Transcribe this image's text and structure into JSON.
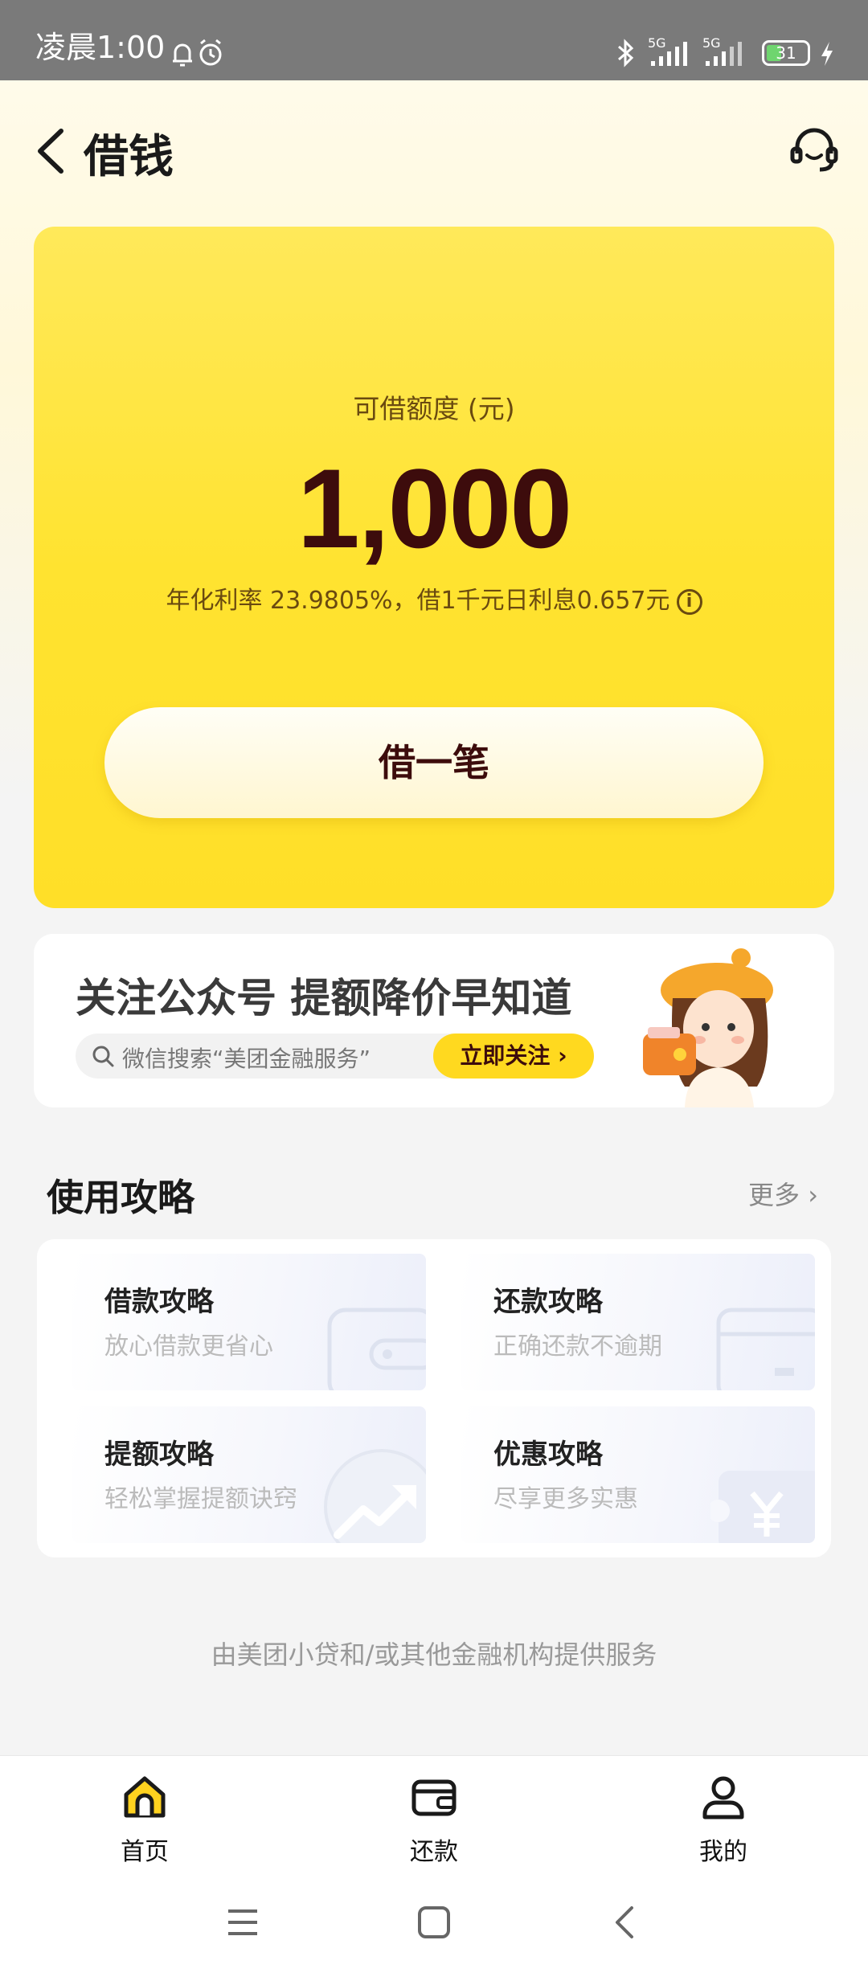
{
  "status_bar": {
    "time": "凌晨1:00",
    "signal_1": "5G",
    "signal_2": "5G",
    "battery": "31"
  },
  "header": {
    "title": "借钱"
  },
  "credit_card": {
    "label": "可借额度 (元)",
    "amount": "1,000",
    "rate_text": "年化利率 23.9805%，借1千元日利息0.657元",
    "button_label": "借一笔"
  },
  "banner": {
    "title": "关注公众号 提额降价早知道",
    "search_text": "微信搜索“美团金融服务”",
    "follow_label": "立即关注 ›"
  },
  "guides": {
    "title": "使用攻略",
    "more_label": "更多 ›",
    "items": [
      {
        "title": "借款攻略",
        "subtitle": "放心借款更省心"
      },
      {
        "title": "还款攻略",
        "subtitle": "正确还款不逾期"
      },
      {
        "title": "提额攻略",
        "subtitle": "轻松掌握提额诀窍"
      },
      {
        "title": "优惠攻略",
        "subtitle": "尽享更多实惠"
      }
    ]
  },
  "provider_text": "由美团小贷和/或其他金融机构提供服务",
  "tabbar": {
    "items": [
      {
        "label": "首页"
      },
      {
        "label": "还款"
      },
      {
        "label": "我的"
      }
    ]
  },
  "colors": {
    "brand_yellow": "#ffe330",
    "text_dark": "#3d0c0c"
  }
}
